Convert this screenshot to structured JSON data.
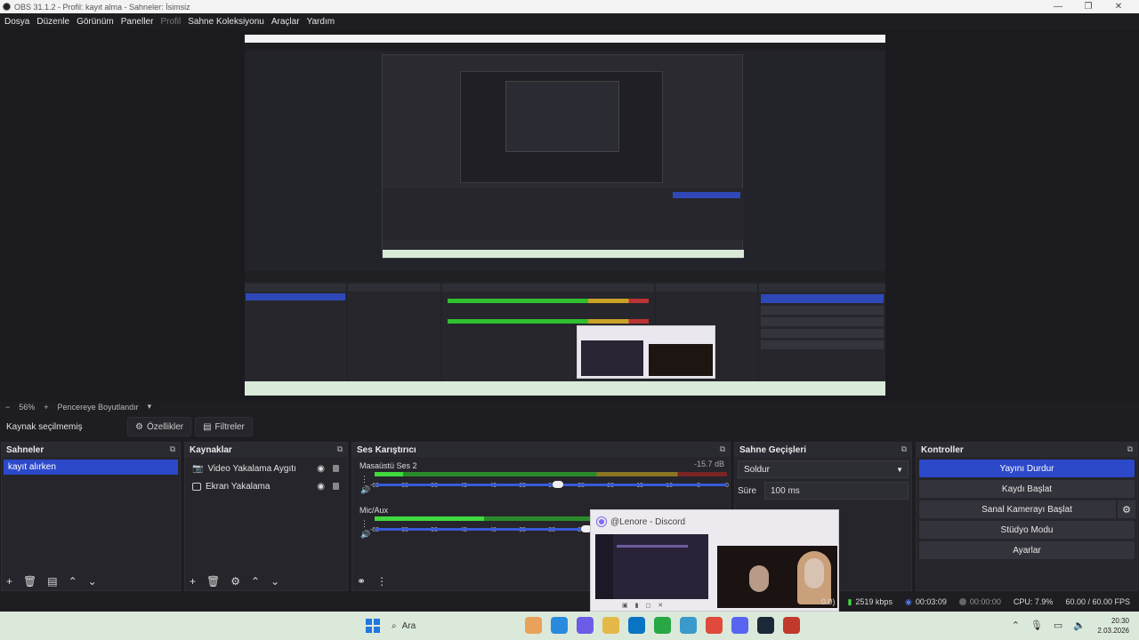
{
  "window": {
    "title": "OBS 31.1.2 - Profil: kayıt alma - Sahneler: İsimsiz",
    "controls": [
      "—",
      "❐",
      "✕"
    ]
  },
  "menu": [
    "Dosya",
    "Düzenle",
    "Görünüm",
    "Paneller",
    "Profil",
    "Sahne Koleksiyonu",
    "Araçlar",
    "Yardım"
  ],
  "preview_bar": {
    "minus": "−",
    "zoom": "56%",
    "plus": "+",
    "fit": "Pencereye Boyutlandır",
    "chevron": "▾"
  },
  "source_bar": {
    "no_source": "Kaynak seçilmemiş",
    "properties": "Özellikler",
    "filters": "Filtreler"
  },
  "scenes": {
    "title": "Sahneler",
    "items": [
      "kayıt alırken"
    ]
  },
  "sources": {
    "title": "Kaynaklar",
    "items": [
      "Video Yakalama Aygıtı",
      "Ekran Yakalama"
    ]
  },
  "mixer": {
    "title": "Ses Karıştırıcı",
    "channels": [
      {
        "name": "Masaüstü Ses 2",
        "db": "-15.7 dB",
        "level": 0.08,
        "volume": 0.52
      },
      {
        "name": "Mic/Aux",
        "db": "",
        "level": 0.31,
        "volume": 0.6
      }
    ],
    "scale": [
      "-60",
      "-55",
      "-50",
      "-45",
      "-40",
      "-35",
      "-30",
      "-25",
      "-20",
      "-15",
      "-10",
      "-5",
      "0"
    ]
  },
  "transitions": {
    "title": "Sahne Geçişleri",
    "selected": "Soldur",
    "duration_label": "Süre",
    "duration_value": "100 ms"
  },
  "controls": {
    "title": "Kontroller",
    "stop_stream": "Yayını Durdur",
    "start_record": "Kaydı Başlat",
    "start_vcam": "Sanal Kamerayı Başlat",
    "studio_mode": "Stüdyo Modu",
    "settings": "Ayarlar"
  },
  "discord_popup": {
    "title": "@Lenore - Discord"
  },
  "status": {
    "dropped": "0.0)",
    "bitrate": "2519 kbps",
    "stream_time": "00:03:09",
    "rec_time": "00:00:00",
    "cpu": "CPU: 7.9%",
    "fps": "60.00 / 60.00 FPS"
  },
  "taskbar": {
    "search": "Ara",
    "time": "20:30",
    "date": "2.03.2026",
    "app_colors": [
      "#e8a25a",
      "#2a8bdc",
      "#6c5ce7",
      "#e4b94a",
      "#0a74c4",
      "#28a745",
      "#3a9ac9",
      "#e04a3a",
      "#5865f2",
      "#1b2838",
      "#c0392b"
    ]
  },
  "colors": {
    "accent": "#2c49c9",
    "panel": "#25252b",
    "background": "#1d1d22"
  }
}
